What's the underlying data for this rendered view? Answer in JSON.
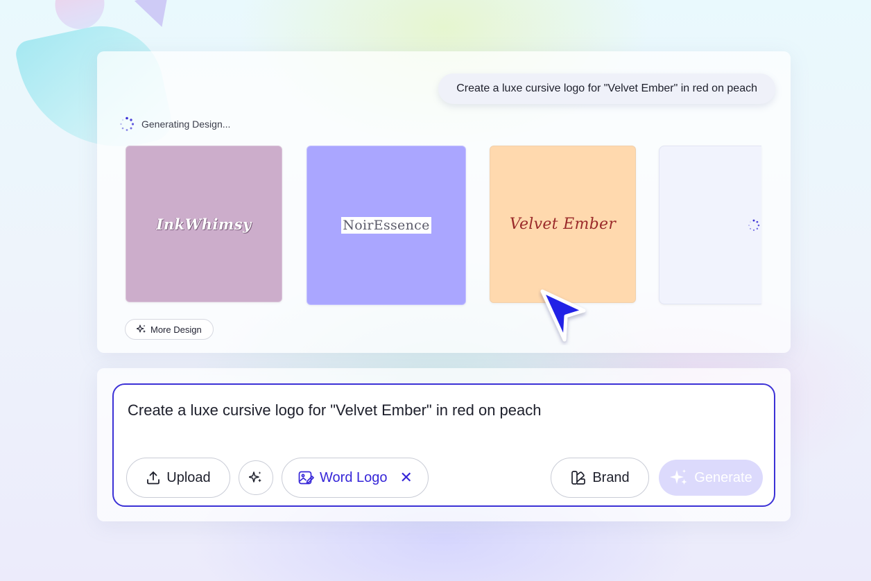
{
  "prompt_bubble": {
    "text": "Create a luxe cursive logo for \"Velvet Ember\" in red on peach"
  },
  "status": {
    "text": "Generating Design..."
  },
  "designs": [
    {
      "logo_text": "InkWhimsy",
      "bg_color": "#ccadcb"
    },
    {
      "logo_text": "NoirEssence",
      "bg_color": "#aaa6ff"
    },
    {
      "logo_text": "Velvet Ember",
      "bg_color": "#ffd9ae"
    },
    {
      "logo_text": "",
      "bg_color": "#f1f3fd",
      "loading": true
    }
  ],
  "more_design": {
    "label": "More Design",
    "icon": "sparkles-icon"
  },
  "composer": {
    "input_value": "Create a luxe cursive logo for \"Velvet Ember\" in red on peach",
    "upload_label": "Upload",
    "upload_icon": "upload-icon",
    "magic_icon": "sparkles-icon",
    "word_logo_label": "Word Logo",
    "word_logo_icon": "image-edit-icon",
    "remove_icon": "close-icon",
    "brand_label": "Brand",
    "brand_icon": "palette-icon",
    "generate_label": "Generate",
    "generate_icon": "sparkles-icon"
  },
  "colors": {
    "accent": "#3c31d6",
    "generate_disabled": "#dcdafc",
    "cursor": "#2323e6"
  }
}
